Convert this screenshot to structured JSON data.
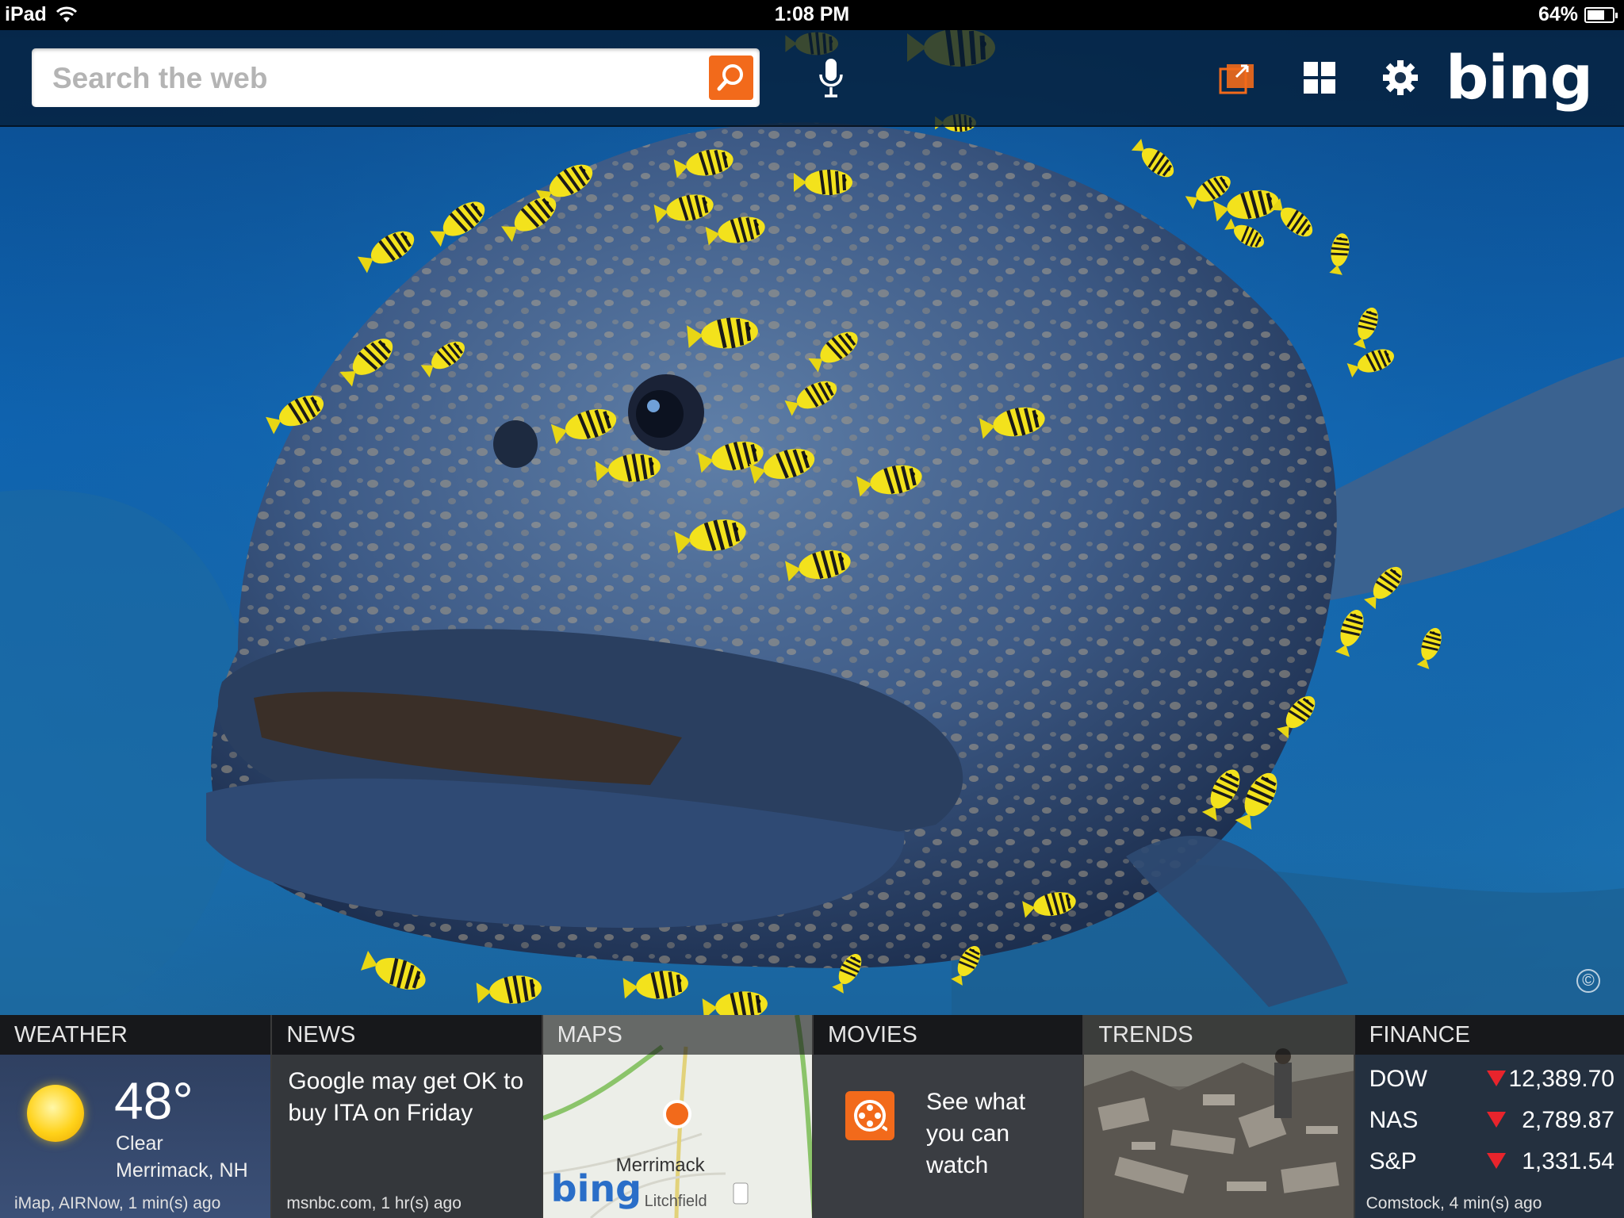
{
  "status_bar": {
    "device": "iPad",
    "time": "1:08 PM",
    "battery": "64%"
  },
  "toolbar": {
    "search_placeholder": "Search the web",
    "logo_text": "bing",
    "icons": [
      "search-icon",
      "microphone-icon",
      "camera-icon",
      "grid-icon",
      "gear-icon"
    ]
  },
  "image_copyright_symbol": "©",
  "panels": {
    "weather": {
      "title": "WEATHER",
      "temperature": "48°",
      "condition": "Clear",
      "location": "Merrimack, NH",
      "source": "iMap, AIRNow, 1 min(s) ago"
    },
    "news": {
      "title": "NEWS",
      "headline": "Google may get OK to buy ITA on Friday",
      "source": "msnbc.com, 1 hr(s) ago"
    },
    "maps": {
      "title": "MAPS",
      "town": "Merrimack",
      "secondary_town": "Litchfield",
      "logo_text": "bing"
    },
    "movies": {
      "title": "MOVIES",
      "text_line1": "See what",
      "text_line2": "you can",
      "text_line3": "watch"
    },
    "trends": {
      "title": "TRENDS"
    },
    "finance": {
      "title": "FINANCE",
      "rows": [
        {
          "name": "DOW",
          "direction": "down",
          "value": "12,389.70"
        },
        {
          "name": "NAS",
          "direction": "down",
          "value": "2,789.87"
        },
        {
          "name": "S&P",
          "direction": "down",
          "value": "1,331.54"
        }
      ],
      "source": "Comstock, 4 min(s) ago"
    }
  },
  "colors": {
    "accent_orange": "#f26a1b",
    "down_red": "#e8242c",
    "fish_yellow": "#f5e01a"
  }
}
